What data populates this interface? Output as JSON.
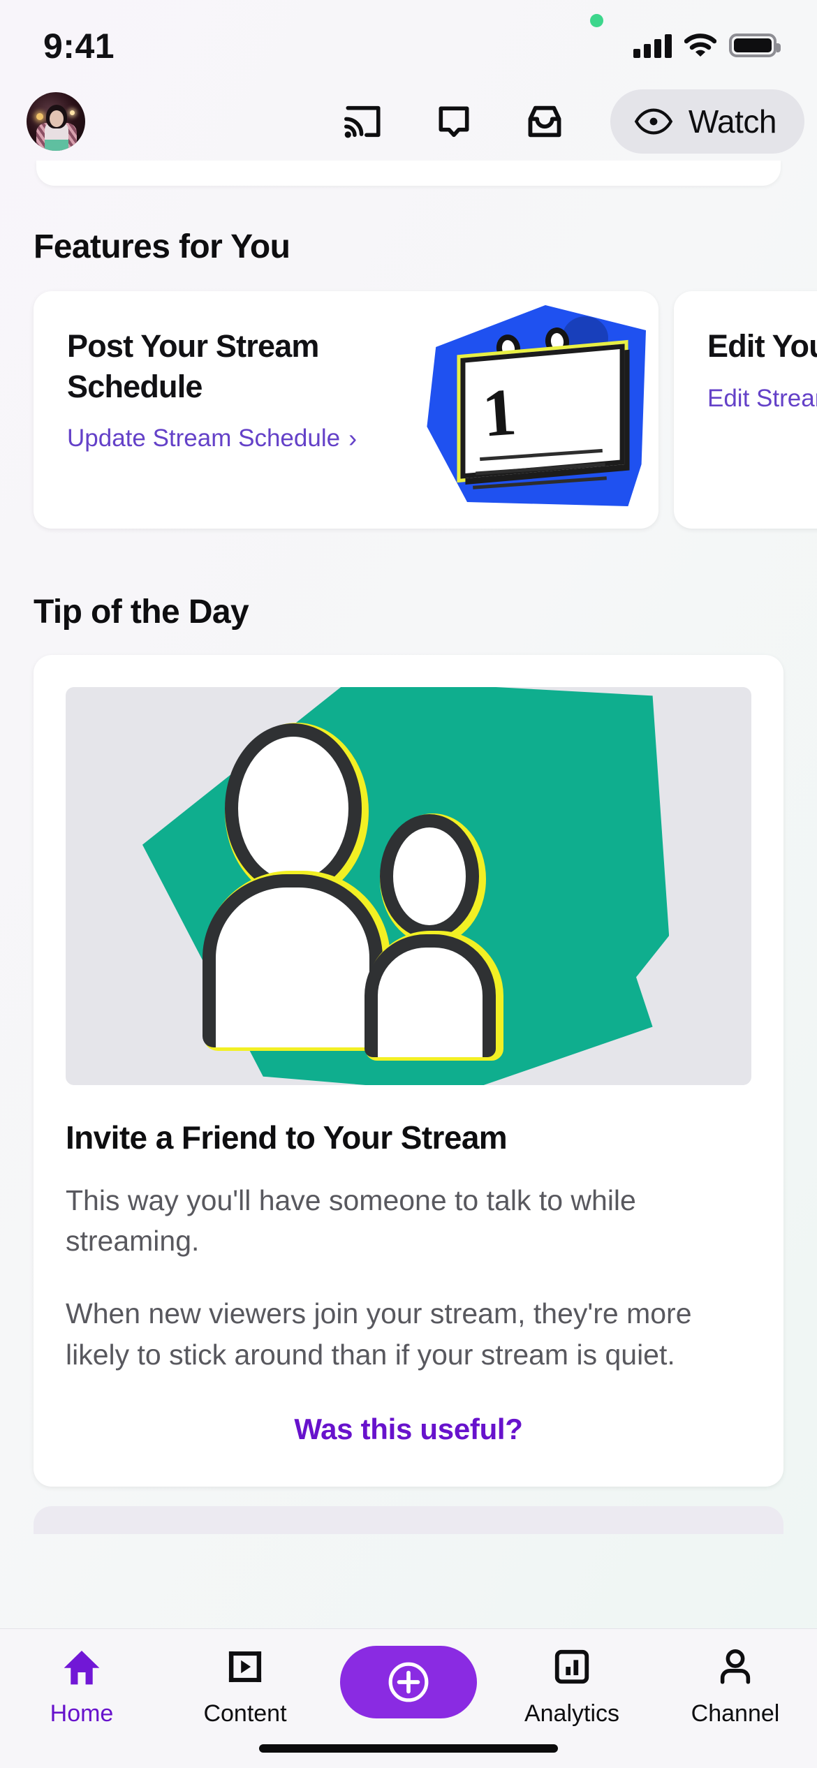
{
  "status_bar": {
    "time": "9:41",
    "signal_icon": "cellular-signal-icon",
    "wifi_icon": "wifi-icon",
    "battery_icon": "battery-icon",
    "recording_indicator": "green-dot-indicator"
  },
  "top_nav": {
    "avatar": "profile-avatar",
    "icons": [
      {
        "name": "cast-icon",
        "label": "Cast"
      },
      {
        "name": "chat-bubble-icon",
        "label": "Chat"
      },
      {
        "name": "inbox-icon",
        "label": "Inbox"
      }
    ],
    "watch_button": {
      "label": "Watch",
      "icon": "eye-icon"
    }
  },
  "features": {
    "section_title": "Features for You",
    "cards": [
      {
        "title": "Post Your Stream Schedule",
        "link": "Update Stream Schedule",
        "chevron": "›",
        "art": "calendar-illustration",
        "art_day": "1",
        "art_bg_color": "#1f51f0",
        "art_accent_color": "#e9f043"
      },
      {
        "title": "Edit Your Stream Info",
        "link": "Edit Stream Info",
        "chevron": "›",
        "art": "stream-info-illustration"
      }
    ]
  },
  "tip_of_the_day": {
    "section_title": "Tip of the Day",
    "image": "two-people-illustration",
    "image_bg_color": "#e5e5ea",
    "image_accent_color": "#0fae8e",
    "title": "Invite a Friend to Your Stream",
    "paragraphs": [
      "This way you'll have someone to talk to while streaming.",
      "When new viewers join your stream, they're more likely to stick around than if your stream is quiet."
    ],
    "useful_link": "Was this useful?"
  },
  "tab_bar": {
    "items": [
      {
        "label": "Home",
        "icon": "home-icon",
        "active": true
      },
      {
        "label": "Content",
        "icon": "content-film-icon",
        "active": false
      },
      {
        "label": "",
        "icon": "create-plus-icon",
        "active": false
      },
      {
        "label": "Analytics",
        "icon": "analytics-bar-chart-icon",
        "active": false
      },
      {
        "label": "Channel",
        "icon": "channel-person-icon",
        "active": false
      }
    ]
  },
  "colors": {
    "accent_purple": "#6712cc",
    "link_purple": "#6441c8",
    "create_purple": "#8a2be2",
    "background": "#f7f6f9"
  }
}
